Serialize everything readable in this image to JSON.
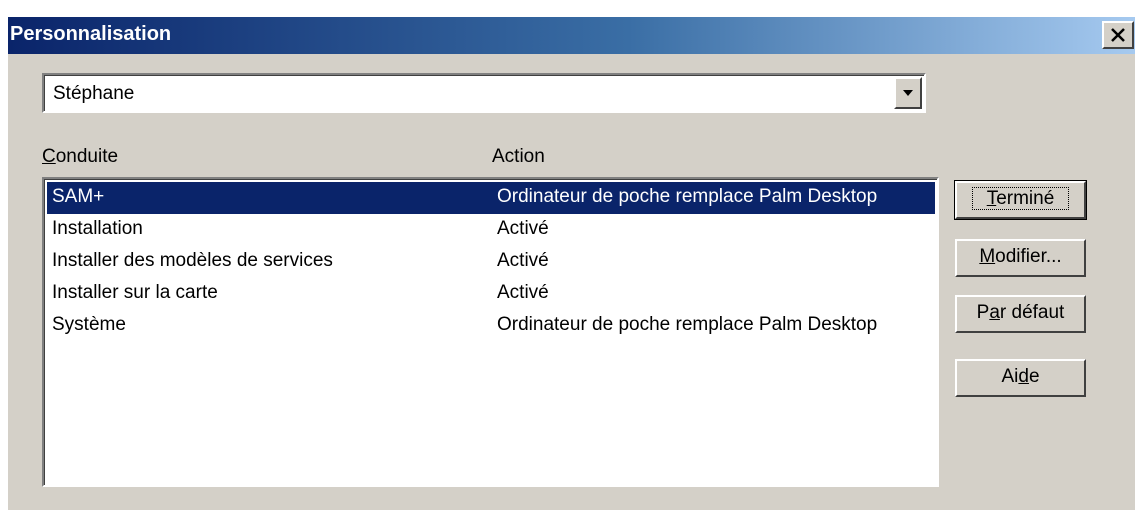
{
  "window": {
    "title": "Personnalisation",
    "close_label": "×"
  },
  "user_select": {
    "value": "Stéphane"
  },
  "list": {
    "columns": {
      "conduit": {
        "mnemonic": "C",
        "rest": "onduite"
      },
      "action": "Action"
    },
    "rows": [
      {
        "conduit": "SAM+",
        "action": "Ordinateur de poche remplace Palm Desktop",
        "selected": true
      },
      {
        "conduit": "Installation",
        "action": "Activé"
      },
      {
        "conduit": "Installer des modèles de services",
        "action": "Activé"
      },
      {
        "conduit": "Installer sur la carte",
        "action": "Activé"
      },
      {
        "conduit": "Système",
        "action": "Ordinateur de poche remplace Palm Desktop"
      }
    ]
  },
  "buttons": {
    "done": {
      "before": "",
      "mnemonic": "T",
      "after": "erminé"
    },
    "modify": {
      "before": "",
      "mnemonic": "M",
      "after": "odifier..."
    },
    "defaults": {
      "before": "P",
      "mnemonic": "a",
      "after": "r défaut"
    },
    "help": {
      "before": "Ai",
      "mnemonic": "d",
      "after": "e"
    }
  },
  "colors": {
    "selection": "#0a246a",
    "face": "#d4d0c8",
    "title_start": "#0a246a",
    "title_end": "#a6caf0"
  }
}
